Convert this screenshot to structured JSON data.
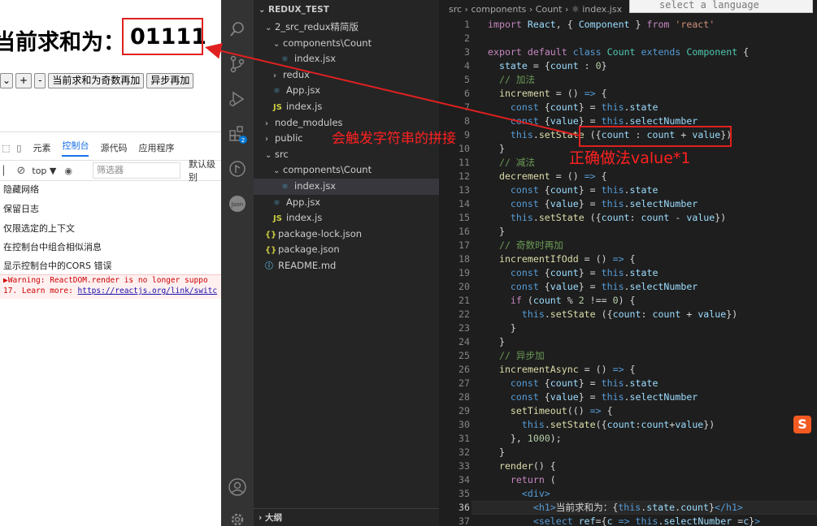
{
  "browser": {
    "heading_label": "当前求和为：",
    "count_value": "01111",
    "controls": {
      "select_value": "1",
      "plus": "+",
      "minus": "-",
      "odd_add": "当前求和为奇数再加",
      "async_add": "异步再加"
    },
    "devtools": {
      "tabs": [
        "元素",
        "控制台",
        "源代码",
        "应用程序"
      ],
      "active_tab": "控制台",
      "context": "top",
      "filter_placeholder": "筛选器",
      "level": "默认级别",
      "menu": [
        "隐藏网络",
        "保留日志",
        "仅限选定的上下文",
        "在控制台中组合相似消息",
        "显示控制台中的CORS 错误"
      ],
      "warning_line1": "▶Warning: ReactDOM.render is no longer suppo",
      "warning_line2_prefix": "17. Learn more: ",
      "warning_link": "https://reactjs.org/link/switc"
    }
  },
  "explorer": {
    "title": "REDUX_TEST",
    "items": [
      {
        "label": "2_src_redux精简版",
        "kind": "folder-open",
        "indent": 1
      },
      {
        "label": "components\\Count",
        "kind": "folder-open",
        "indent": 2
      },
      {
        "label": "index.jsx",
        "kind": "react",
        "indent": 3
      },
      {
        "label": "redux",
        "kind": "folder",
        "indent": 2
      },
      {
        "label": "App.jsx",
        "kind": "react",
        "indent": 2
      },
      {
        "label": "index.js",
        "kind": "js",
        "indent": 2
      },
      {
        "label": "node_modules",
        "kind": "folder",
        "indent": 1
      },
      {
        "label": "public",
        "kind": "folder",
        "indent": 1
      },
      {
        "label": "src",
        "kind": "folder-open",
        "indent": 1
      },
      {
        "label": "components\\Count",
        "kind": "folder-open",
        "indent": 2
      },
      {
        "label": "index.jsx",
        "kind": "react",
        "indent": 3,
        "selected": true
      },
      {
        "label": "App.jsx",
        "kind": "react",
        "indent": 2
      },
      {
        "label": "index.js",
        "kind": "js",
        "indent": 2
      },
      {
        "label": "package-lock.json",
        "kind": "json",
        "indent": 1
      },
      {
        "label": "package.json",
        "kind": "json",
        "indent": 1
      },
      {
        "label": "README.md",
        "kind": "info",
        "indent": 1
      }
    ],
    "outline": "大纲"
  },
  "editor": {
    "breadcrumb": "src › components › Count › ⚛ index.jsx",
    "language_placeholder": "select a language",
    "current_line": 36
  },
  "annotations": {
    "string_concat": "会触发字符串的拼接",
    "correct": "正确做法value*1"
  },
  "colors": {
    "annotation_red": "#e02020",
    "editor_bg": "#1e1e1e",
    "sidebar_bg": "#252526",
    "activity_bg": "#333333"
  }
}
